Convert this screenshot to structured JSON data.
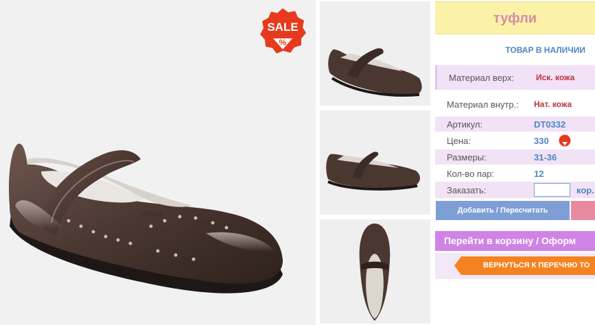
{
  "sale_badge": {
    "label": "SALE",
    "symbol": "%"
  },
  "product": {
    "title": "туфли",
    "stock_status": "ТОВАР В НАЛИЧИИ"
  },
  "specs": {
    "material_top": {
      "label": "Материал верх:",
      "value": "Иск. кожа"
    },
    "material_inner": {
      "label": "Материал внутр.:",
      "value": "Нат. кожа"
    },
    "article": {
      "label": "Артикул:",
      "value": "DT0332"
    },
    "price": {
      "label": "Цена:",
      "value": "330"
    },
    "sizes": {
      "label": "Размеры:",
      "value": "31-36"
    },
    "pairs": {
      "label": "Кол-во пар:",
      "value": "12"
    }
  },
  "order": {
    "label": "Заказать:",
    "quantity_value": "",
    "unit": "кор."
  },
  "buttons": {
    "add_recalc": "Добавить / Пересчитать",
    "go_to_cart": "Перейти в корзину / Оформ",
    "back_to_list": "ВЕРНУТЬСЯ К ПЕРЕЧНЮ ТО"
  },
  "colors": {
    "title_bg": "#fbf2a8",
    "title_text": "#d68aa8",
    "accent_blue": "#4d86c2",
    "value_red": "#b8343a",
    "band_pink": "#f2e2f6",
    "add_button": "#7e9fd6",
    "cart_purple": "#cf84e5",
    "back_orange": "#f58220",
    "sale_red": "#e63a1e"
  }
}
